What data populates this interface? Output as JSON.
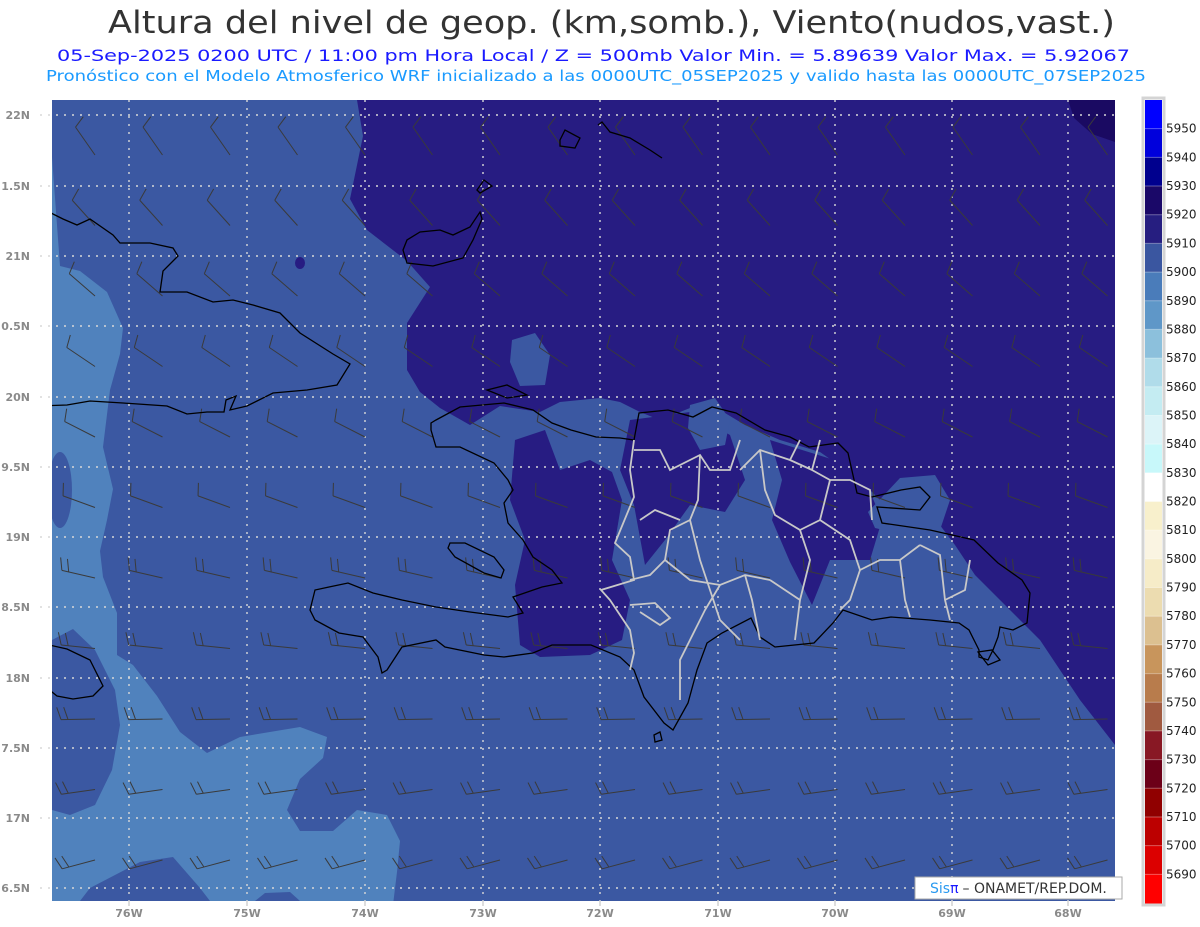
{
  "header": {
    "title": "Altura del nivel de geop. (km,somb.), Viento(nudos,vast.)",
    "subtitle": "05-Sep-2025  0200 UTC / 11:00 pm Hora Local / Z = 500mb    Valor Min. = 5.89639   Valor Max. = 5.92067",
    "model_line": "Pronóstico con el Modelo Atmosferico WRF inicializado a las 0000UTC_05SEP2025 y valido hasta las  0000UTC_07SEP2025"
  },
  "axes": {
    "lon_labels": [
      "76W",
      "75W",
      "74W",
      "73W",
      "72W",
      "71W",
      "70W",
      "69W",
      "68W"
    ],
    "lat_labels": [
      "22N",
      "1.5N",
      "21N",
      "0.5N",
      "20N",
      "9.5N",
      "19N",
      "8.5N",
      "18N",
      "7.5N",
      "17N",
      "6.5N"
    ]
  },
  "colorbar": {
    "labels": [
      "5950",
      "5940",
      "5930",
      "5920",
      "5910",
      "5900",
      "5890",
      "5880",
      "5870",
      "5860",
      "5850",
      "5840",
      "5830",
      "5820",
      "5810",
      "5800",
      "5790",
      "5780",
      "5770",
      "5760",
      "5750",
      "5740",
      "5730",
      "5720",
      "5710",
      "5700",
      "5690"
    ],
    "colors": [
      "#0000ff",
      "#0000dc",
      "#00008e",
      "#1a0868",
      "#261e80",
      "#3a56a0",
      "#4a7cba",
      "#5f97c8",
      "#8cc0dc",
      "#b0dcea",
      "#c4ecf2",
      "#dcf4f8",
      "#c8f8fa",
      "#ffffff",
      "#f8f0cc",
      "#faf4e2",
      "#f6ecc8",
      "#ecdcb0",
      "#dcc090",
      "#c8955c",
      "#b87c4c",
      "#a05a40",
      "#881824",
      "#6c0018",
      "#900000",
      "#bc0000",
      "#dc0000",
      "#ff0000"
    ]
  },
  "field_colors": {
    "light": "#5082bd",
    "mid": "#3b58a2",
    "dark": "#271c82",
    "darkest": "#1a0a62"
  },
  "credit": {
    "brand_sis": "Sis",
    "brand_pi": "π",
    "text": "– ONAMET/REP.DOM."
  }
}
